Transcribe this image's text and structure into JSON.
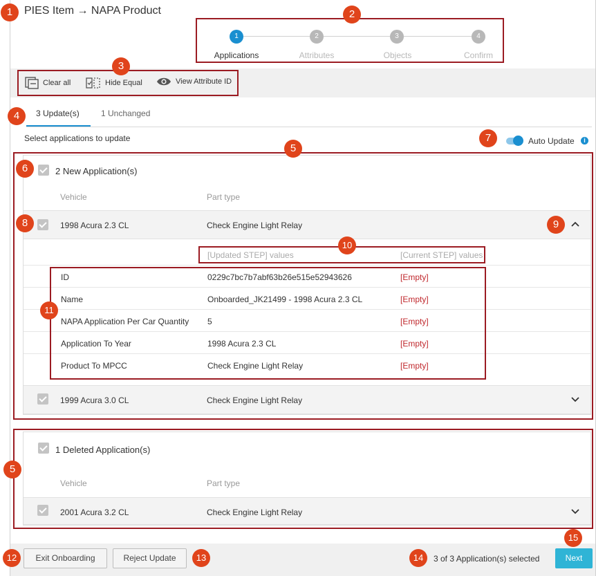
{
  "title": "PIES Item → NAPA Product",
  "stepper": [
    {
      "num": "1",
      "label": "Applications"
    },
    {
      "num": "2",
      "label": "Attributes"
    },
    {
      "num": "3",
      "label": "Objects"
    },
    {
      "num": "4",
      "label": "Confirm"
    }
  ],
  "toolbar": {
    "clear_all": "Clear all",
    "hide_equal": "Hide Equal",
    "view_attr_id": "View Attribute ID"
  },
  "tabs": [
    {
      "label": "3 Update(s)"
    },
    {
      "label": "1 Unchanged"
    }
  ],
  "instruction": "Select applications to update",
  "auto_update": {
    "label": "Auto Update",
    "on": true,
    "info": "i"
  },
  "new_group": {
    "title": "2 New Application(s)",
    "col_vehicle": "Vehicle",
    "col_part_type": "Part type",
    "rows": [
      {
        "vehicle": "1998 Acura 2.3 CL",
        "part_type": "Check Engine Light Relay"
      },
      {
        "vehicle": "1999 Acura 3.0 CL",
        "part_type": "Check Engine Light Relay"
      }
    ],
    "details_head": {
      "updated": "[Updated STEP] values",
      "current": "[Current STEP] values"
    },
    "details": [
      {
        "attr": "ID",
        "updated": "0229c7bc7b7abf63b26e515e52943626",
        "current": "[Empty]"
      },
      {
        "attr": "Name",
        "updated": "Onboarded_JK21499 - 1998 Acura 2.3 CL",
        "current": "[Empty]"
      },
      {
        "attr": "NAPA Application Per Car Quantity",
        "updated": "5",
        "current": "[Empty]"
      },
      {
        "attr": "Application To Year",
        "updated": "1998 Acura 2.3 CL",
        "current": "[Empty]"
      },
      {
        "attr": "Product To MPCC",
        "updated": "Check Engine Light Relay",
        "current": "[Empty]"
      }
    ]
  },
  "deleted_group": {
    "title": "1 Deleted Application(s)",
    "col_vehicle": "Vehicle",
    "col_part_type": "Part type",
    "rows": [
      {
        "vehicle": "2001 Acura 3.2 CL",
        "part_type": "Check Engine Light Relay"
      }
    ]
  },
  "footer": {
    "exit": "Exit Onboarding",
    "reject": "Reject Update",
    "selected": "3 of 3 Application(s) selected",
    "next": "Next"
  },
  "callouts": [
    "1",
    "2",
    "3",
    "4",
    "5",
    "5",
    "6",
    "7",
    "8",
    "9",
    "10",
    "11",
    "12",
    "13",
    "14",
    "15"
  ],
  "colors": {
    "accent": "#1a8fd0",
    "callout": "#e0441b",
    "highlight_box": "#9b1b22",
    "empty": "#c0282d",
    "next": "#2fb4d6"
  }
}
